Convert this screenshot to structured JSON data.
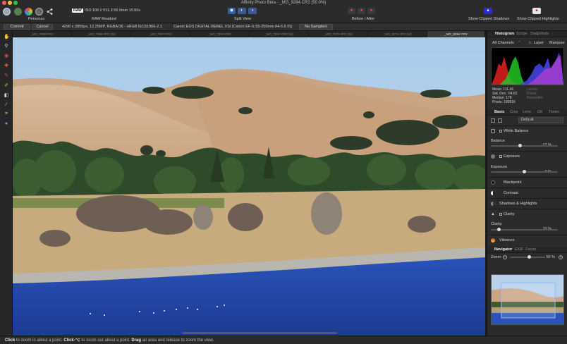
{
  "window": {
    "title": "Affinity Photo Beta - _MG_9294.CR2 (50.0%)"
  },
  "toolbar": {
    "personas_label": "Personas",
    "raw_badge": "RAW",
    "raw_info": "ISO 100 // f/11.3 55.0mm 1/160s",
    "raw_readout_label": "RAW Readout",
    "split_view_label": "Split View",
    "before_after_label": "Before / After",
    "show_clipped_shadows_label": "Show Clipped Shadows",
    "show_clipped_highlights_label": "Show Clipped Highlights"
  },
  "context": {
    "commit_label": "Commit",
    "cancel_label": "Cancel",
    "image_info": "4290 x 2856px, 12.25MP, RGBA/16 - sRGB IEC61966-2.1",
    "camera_info": "Canon EOS DIGITAL REBEL XSi (Canon EF-S 55-250mm f/4-5.6 IS)",
    "no_samplers_label": "No Samplers"
  },
  "doc_tabs": [
    {
      "label": "_MG_7909.CR2",
      "active": false
    },
    {
      "label": "_MG_7969.JPG (M)",
      "active": false
    },
    {
      "label": "_MG_7937.CR2",
      "active": false
    },
    {
      "label": "_MG_7903.CR2",
      "active": false
    },
    {
      "label": "_MG_7891.CR2 (M)",
      "active": false
    },
    {
      "label": "_MG_7976.JPG (M)",
      "active": false
    },
    {
      "label": "_MG_8274.JPG (M)",
      "active": false
    },
    {
      "label": "_MG_9294.CR2",
      "active": true
    }
  ],
  "status": {
    "click": "Click",
    "t1": " to zoom in about a point. ",
    "click_alt": "Click-⌥",
    "t2": " to zoom out about a point. ",
    "drag": "Drag",
    "t3": " an area and release to zoom the view."
  },
  "panel": {
    "top_tabs": [
      "Histogram",
      "Scope",
      "Snapshots"
    ],
    "channel_select": "All Channels",
    "layer_label": "Layer",
    "marquee_label": "Marquee",
    "stats_left": [
      {
        "label": "Mean:",
        "value": "111.44"
      },
      {
        "label": "Std. Dev.:",
        "value": "64.82"
      },
      {
        "label": "Median:",
        "value": "178"
      },
      {
        "label": "Pixels:",
        "value": "190816"
      }
    ],
    "stats_right": [
      "Levels:",
      "Pixels:",
      "Percentile:"
    ],
    "adj_tabs": [
      "Basic",
      "Crvs",
      "Lens",
      "Dtl",
      "Tones"
    ],
    "preset_select": "Default",
    "adjustments": [
      {
        "label": "White Balance",
        "checked": true
      },
      {
        "label": "Exposure",
        "checked": true
      },
      {
        "label": "Blackpoint",
        "checked": false
      },
      {
        "label": "Contrast",
        "checked": false
      },
      {
        "label": "Shadows & Highlights",
        "checked": false
      },
      {
        "label": "Clarity",
        "checked": true
      },
      {
        "label": "Vibrance",
        "checked": false
      }
    ],
    "sliders": {
      "balance": {
        "label": "Balance",
        "value": "-12 %",
        "level": 0.44
      },
      "exposure": {
        "label": "Exposure",
        "value": "0 %",
        "level": 0.5
      },
      "clarity": {
        "label": "Clarity",
        "value": "10 %",
        "level": 0.12
      }
    },
    "nav_tabs": [
      "Navigator",
      "EXIF",
      "Focus"
    ],
    "zoom_label": "Zoom:",
    "zoom_value": "50 %",
    "zoom_level": 0.55
  },
  "colors": {
    "accent": "#2f5fa8",
    "histogram_red": "#e32020",
    "histogram_green": "#22c423",
    "histogram_blue": "#4a4aff"
  }
}
